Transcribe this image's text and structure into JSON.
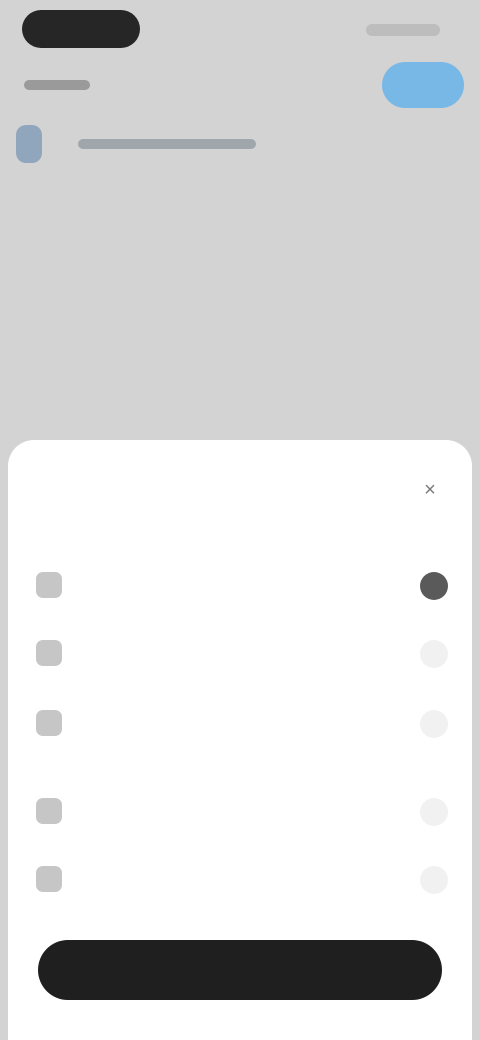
{
  "sheet": {
    "title": "",
    "close_glyph": "×",
    "options": [
      {
        "icon": "document-icon",
        "label": "",
        "selected": true
      },
      {
        "icon": "clock-icon",
        "label": "",
        "selected": false
      },
      {
        "icon": "calendar-icon",
        "label": "",
        "selected": false
      },
      {
        "icon": "list-icon",
        "label": "",
        "selected": false
      },
      {
        "icon": "user-icon",
        "label": "",
        "selected": false
      }
    ]
  },
  "cta_label": "",
  "colors": {
    "accent_blue": "#78b8e6",
    "dark": "#1f1f1f",
    "sheet": "#ffffff",
    "overlay": "#d2d2d2"
  }
}
